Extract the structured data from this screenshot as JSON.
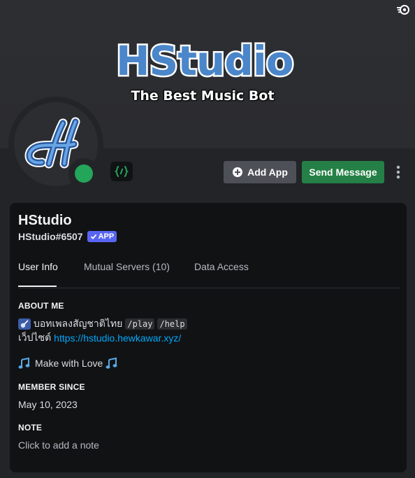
{
  "banner": {
    "title": "HStudio",
    "subtitle": "The Best Music Bot",
    "icon": "nitro-boost-icon"
  },
  "actions": {
    "add_app_label": "Add App",
    "send_message_label": "Send Message",
    "more_icon": "more-vertical-icon"
  },
  "profile": {
    "display_name": "HStudio",
    "tag": "HStudio#6507",
    "app_badge": "APP",
    "status_color": "#23a55a",
    "avatar_icon": "hstudio-logo-icon",
    "badge_icon": "code-braces-icon"
  },
  "tabs": [
    {
      "label": "User Info",
      "active": true
    },
    {
      "label": "Mutual Servers (10)",
      "active": false
    },
    {
      "label": "Data Access",
      "active": false
    }
  ],
  "about": {
    "heading": "ABOUT ME",
    "line1_text": "บอทเพลงสัญชาติไทย",
    "cmd1": "/play",
    "cmd2": "/help",
    "line2_prefix": "เว็ปไซต์",
    "website": "https://hstudio.hewkawar.xyz/",
    "line3": "Make with Love"
  },
  "member_since": {
    "heading": "MEMBER SINCE",
    "value": "May 10, 2023"
  },
  "note": {
    "heading": "NOTE",
    "placeholder": "Click to add a note"
  },
  "colors": {
    "background": "#232428",
    "card": "#111214",
    "primary_button": "#248046",
    "secondary_button": "#4e5058",
    "app_badge": "#5865f2",
    "link": "#00a8fc"
  }
}
